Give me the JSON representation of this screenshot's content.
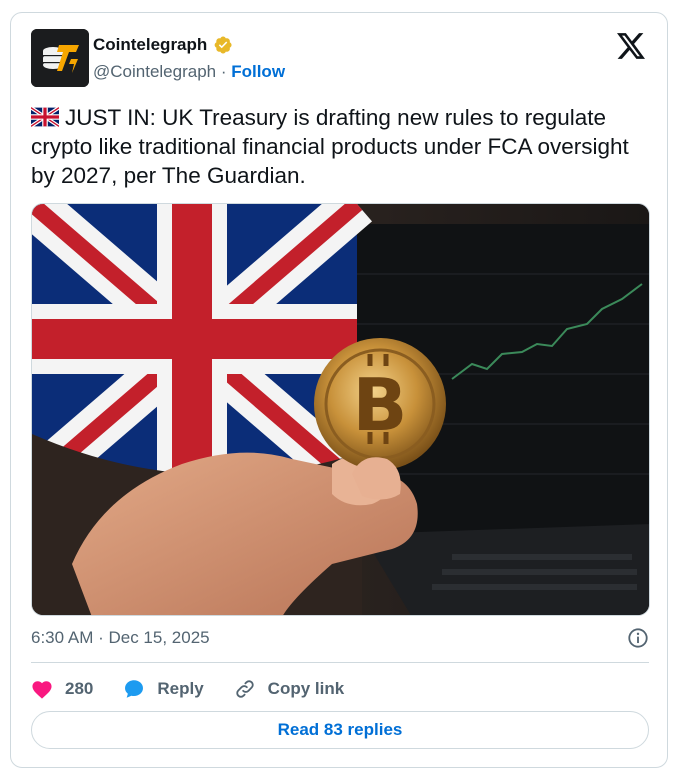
{
  "author": {
    "display_name": "Cointelegraph",
    "handle": "@Cointelegraph",
    "separator": " · ",
    "follow_label": "Follow",
    "verified_color": "#e8b829",
    "avatar_icon": "cointelegraph-logo"
  },
  "platform_icon": "x-logo",
  "tweet": {
    "flag_icon": "uk-flag-emoji",
    "text": "JUST IN: UK Treasury is drafting new rules to regulate crypto like traditional financial products under FCA oversight by 2027, per The Guardian.",
    "media_description_icon": "bitcoin-coin-image"
  },
  "meta": {
    "timestamp": "6:30 AM · Dec 15, 2025",
    "info_icon": "info-icon"
  },
  "actions": {
    "likes_count": "280",
    "like_icon": "heart-icon",
    "like_color": "#f91880",
    "reply_label": "Reply",
    "reply_icon": "reply-bubble-icon",
    "reply_color": "#1d9bf0",
    "copy_label": "Copy link",
    "copy_icon": "link-icon"
  },
  "read_replies_label": "Read 83 replies",
  "colors": {
    "accent": "#006fd6",
    "muted_text": "#536471",
    "border": "#cfd9de"
  }
}
